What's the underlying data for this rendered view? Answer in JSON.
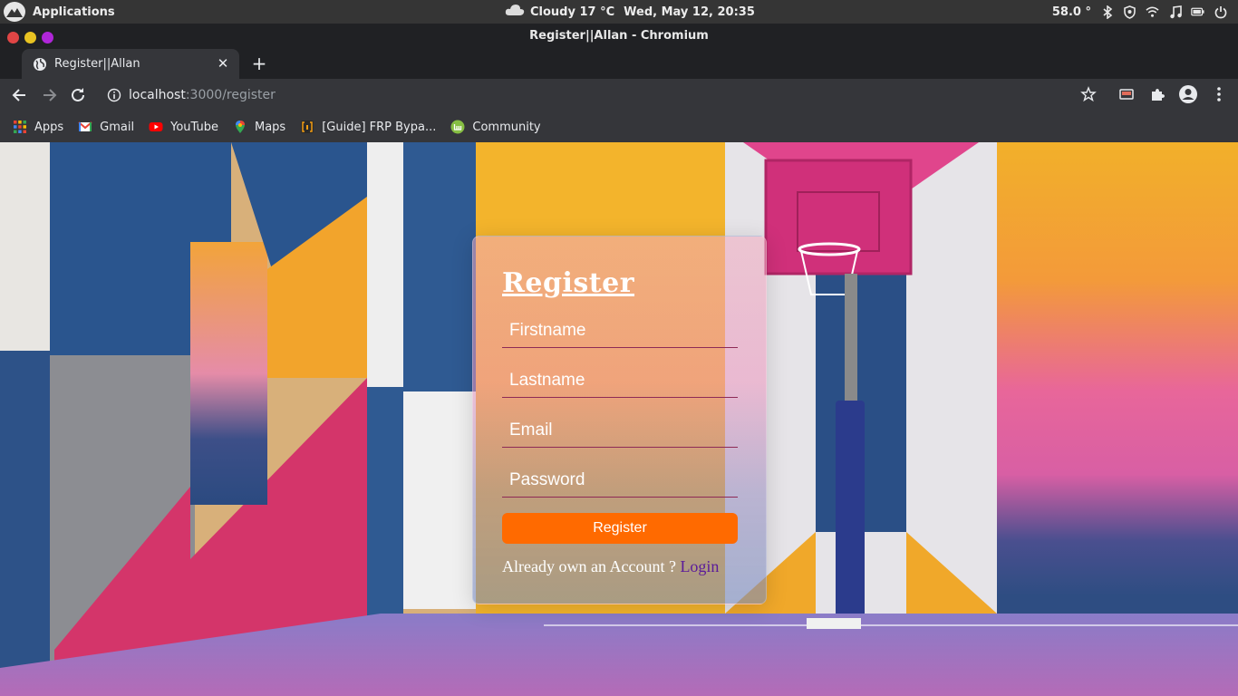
{
  "os": {
    "apps_label": "Applications",
    "weather": "Cloudy 17 °C",
    "datetime": "Wed, May 12, 20:35",
    "temperature": "58.0 °",
    "tray_icons": [
      "bluetooth-icon",
      "vpn-shield-icon",
      "wifi-icon",
      "music-icon",
      "battery-icon",
      "power-icon"
    ]
  },
  "window": {
    "title": "Register||Allan - Chromium",
    "controls_colors": [
      "#e04545",
      "#e8c322",
      "#b026d9"
    ]
  },
  "tabs": [
    {
      "label": "Register||Allan",
      "active": true
    }
  ],
  "toolbar": {
    "url_host": "localhost",
    "url_path": ":3000/register"
  },
  "bookmarks": [
    {
      "label": "Apps",
      "icon": "apps-grid-icon"
    },
    {
      "label": "Gmail",
      "icon": "gmail-icon"
    },
    {
      "label": "YouTube",
      "icon": "youtube-icon"
    },
    {
      "label": "Maps",
      "icon": "maps-icon"
    },
    {
      "label": "[Guide] FRP Bypa...",
      "icon": "guide-icon"
    },
    {
      "label": "Community",
      "icon": "community-icon"
    }
  ],
  "form": {
    "title": "Register",
    "firstname_placeholder": "Firstname",
    "lastname_placeholder": "Lastname",
    "email_placeholder": "Email",
    "password_placeholder": "Password",
    "submit_label": "Register",
    "already_text": "Already own an Account ?",
    "login_link": "Login",
    "accent_color": "#ff6a00"
  }
}
